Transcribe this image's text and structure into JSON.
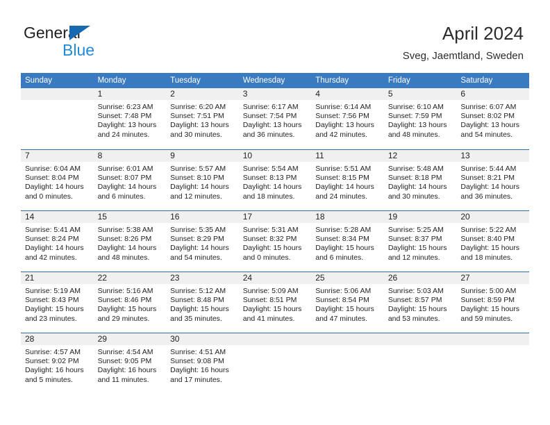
{
  "brand": {
    "name_part1": "General",
    "name_part2": "Blue",
    "accent_color": "#1769b0",
    "blue_text_color": "#1f8ad6"
  },
  "header": {
    "title": "April 2024",
    "subtitle": "Sveg, Jaemtland, Sweden"
  },
  "calendar": {
    "header_bg_color": "#3a7ac0",
    "daynum_bg_color": "#f0f0f0",
    "separator_color": "#2e6ca8",
    "weekday_headers": [
      "Sunday",
      "Monday",
      "Tuesday",
      "Wednesday",
      "Thursday",
      "Friday",
      "Saturday"
    ],
    "weeks": [
      [
        {
          "day": "",
          "sunrise": "",
          "sunset": "",
          "daylight": "",
          "empty": true
        },
        {
          "day": "1",
          "sunrise": "Sunrise: 6:23 AM",
          "sunset": "Sunset: 7:48 PM",
          "daylight": "Daylight: 13 hours and 24 minutes."
        },
        {
          "day": "2",
          "sunrise": "Sunrise: 6:20 AM",
          "sunset": "Sunset: 7:51 PM",
          "daylight": "Daylight: 13 hours and 30 minutes."
        },
        {
          "day": "3",
          "sunrise": "Sunrise: 6:17 AM",
          "sunset": "Sunset: 7:54 PM",
          "daylight": "Daylight: 13 hours and 36 minutes."
        },
        {
          "day": "4",
          "sunrise": "Sunrise: 6:14 AM",
          "sunset": "Sunset: 7:56 PM",
          "daylight": "Daylight: 13 hours and 42 minutes."
        },
        {
          "day": "5",
          "sunrise": "Sunrise: 6:10 AM",
          "sunset": "Sunset: 7:59 PM",
          "daylight": "Daylight: 13 hours and 48 minutes."
        },
        {
          "day": "6",
          "sunrise": "Sunrise: 6:07 AM",
          "sunset": "Sunset: 8:02 PM",
          "daylight": "Daylight: 13 hours and 54 minutes."
        }
      ],
      [
        {
          "day": "7",
          "sunrise": "Sunrise: 6:04 AM",
          "sunset": "Sunset: 8:04 PM",
          "daylight": "Daylight: 14 hours and 0 minutes."
        },
        {
          "day": "8",
          "sunrise": "Sunrise: 6:01 AM",
          "sunset": "Sunset: 8:07 PM",
          "daylight": "Daylight: 14 hours and 6 minutes."
        },
        {
          "day": "9",
          "sunrise": "Sunrise: 5:57 AM",
          "sunset": "Sunset: 8:10 PM",
          "daylight": "Daylight: 14 hours and 12 minutes."
        },
        {
          "day": "10",
          "sunrise": "Sunrise: 5:54 AM",
          "sunset": "Sunset: 8:13 PM",
          "daylight": "Daylight: 14 hours and 18 minutes."
        },
        {
          "day": "11",
          "sunrise": "Sunrise: 5:51 AM",
          "sunset": "Sunset: 8:15 PM",
          "daylight": "Daylight: 14 hours and 24 minutes."
        },
        {
          "day": "12",
          "sunrise": "Sunrise: 5:48 AM",
          "sunset": "Sunset: 8:18 PM",
          "daylight": "Daylight: 14 hours and 30 minutes."
        },
        {
          "day": "13",
          "sunrise": "Sunrise: 5:44 AM",
          "sunset": "Sunset: 8:21 PM",
          "daylight": "Daylight: 14 hours and 36 minutes."
        }
      ],
      [
        {
          "day": "14",
          "sunrise": "Sunrise: 5:41 AM",
          "sunset": "Sunset: 8:24 PM",
          "daylight": "Daylight: 14 hours and 42 minutes."
        },
        {
          "day": "15",
          "sunrise": "Sunrise: 5:38 AM",
          "sunset": "Sunset: 8:26 PM",
          "daylight": "Daylight: 14 hours and 48 minutes."
        },
        {
          "day": "16",
          "sunrise": "Sunrise: 5:35 AM",
          "sunset": "Sunset: 8:29 PM",
          "daylight": "Daylight: 14 hours and 54 minutes."
        },
        {
          "day": "17",
          "sunrise": "Sunrise: 5:31 AM",
          "sunset": "Sunset: 8:32 PM",
          "daylight": "Daylight: 15 hours and 0 minutes."
        },
        {
          "day": "18",
          "sunrise": "Sunrise: 5:28 AM",
          "sunset": "Sunset: 8:34 PM",
          "daylight": "Daylight: 15 hours and 6 minutes."
        },
        {
          "day": "19",
          "sunrise": "Sunrise: 5:25 AM",
          "sunset": "Sunset: 8:37 PM",
          "daylight": "Daylight: 15 hours and 12 minutes."
        },
        {
          "day": "20",
          "sunrise": "Sunrise: 5:22 AM",
          "sunset": "Sunset: 8:40 PM",
          "daylight": "Daylight: 15 hours and 18 minutes."
        }
      ],
      [
        {
          "day": "21",
          "sunrise": "Sunrise: 5:19 AM",
          "sunset": "Sunset: 8:43 PM",
          "daylight": "Daylight: 15 hours and 23 minutes."
        },
        {
          "day": "22",
          "sunrise": "Sunrise: 5:16 AM",
          "sunset": "Sunset: 8:46 PM",
          "daylight": "Daylight: 15 hours and 29 minutes."
        },
        {
          "day": "23",
          "sunrise": "Sunrise: 5:12 AM",
          "sunset": "Sunset: 8:48 PM",
          "daylight": "Daylight: 15 hours and 35 minutes."
        },
        {
          "day": "24",
          "sunrise": "Sunrise: 5:09 AM",
          "sunset": "Sunset: 8:51 PM",
          "daylight": "Daylight: 15 hours and 41 minutes."
        },
        {
          "day": "25",
          "sunrise": "Sunrise: 5:06 AM",
          "sunset": "Sunset: 8:54 PM",
          "daylight": "Daylight: 15 hours and 47 minutes."
        },
        {
          "day": "26",
          "sunrise": "Sunrise: 5:03 AM",
          "sunset": "Sunset: 8:57 PM",
          "daylight": "Daylight: 15 hours and 53 minutes."
        },
        {
          "day": "27",
          "sunrise": "Sunrise: 5:00 AM",
          "sunset": "Sunset: 8:59 PM",
          "daylight": "Daylight: 15 hours and 59 minutes."
        }
      ],
      [
        {
          "day": "28",
          "sunrise": "Sunrise: 4:57 AM",
          "sunset": "Sunset: 9:02 PM",
          "daylight": "Daylight: 16 hours and 5 minutes."
        },
        {
          "day": "29",
          "sunrise": "Sunrise: 4:54 AM",
          "sunset": "Sunset: 9:05 PM",
          "daylight": "Daylight: 16 hours and 11 minutes."
        },
        {
          "day": "30",
          "sunrise": "Sunrise: 4:51 AM",
          "sunset": "Sunset: 9:08 PM",
          "daylight": "Daylight: 16 hours and 17 minutes."
        },
        {
          "day": "",
          "sunrise": "",
          "sunset": "",
          "daylight": "",
          "empty": true
        },
        {
          "day": "",
          "sunrise": "",
          "sunset": "",
          "daylight": "",
          "empty": true
        },
        {
          "day": "",
          "sunrise": "",
          "sunset": "",
          "daylight": "",
          "empty": true
        },
        {
          "day": "",
          "sunrise": "",
          "sunset": "",
          "daylight": "",
          "empty": true
        }
      ]
    ]
  }
}
